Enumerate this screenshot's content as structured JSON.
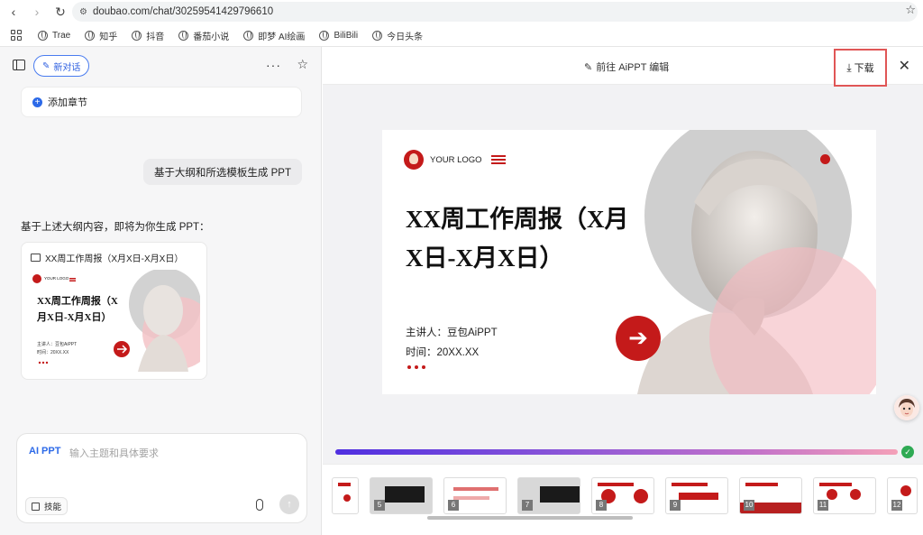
{
  "browser": {
    "url": "doubao.com/chat/30259541429796610",
    "bookmarks": [
      {
        "label": "Trae",
        "icon": "globe-icon"
      },
      {
        "label": "知乎",
        "icon": "globe-icon"
      },
      {
        "label": "抖音",
        "icon": "globe-icon"
      },
      {
        "label": "番茄小说",
        "icon": "globe-icon"
      },
      {
        "label": "即梦 AI绘画",
        "icon": "globe-icon"
      },
      {
        "label": "BiliBili",
        "icon": "globe-icon"
      },
      {
        "label": "今日头条",
        "icon": "globe-icon"
      }
    ]
  },
  "chat": {
    "new_chat_label": "新对话",
    "add_chapter_label": "添加章节",
    "user_message": "基于大纲和所选模板生成 PPT",
    "bot_message": "基于上述大纲内容，即将为你生成 PPT：",
    "ppt_card_title": "XX周工作周报（X月X日-X月X日）",
    "mini_slide": {
      "logo_text": "YOUR LOGO",
      "title": "XX周工作周报（X月X日-X月X日）",
      "presenter": "主讲人：豆包AiPPT",
      "time": "时间：20XX.XX"
    },
    "input": {
      "tag": "AI PPT",
      "placeholder": "输入主题和具体要求",
      "skill_label": "技能"
    }
  },
  "preview": {
    "goto_edit_label": "前往 AiPPT 编辑",
    "download_label": "下载",
    "slide": {
      "logo_text": "YOUR LOGO",
      "title": "XX周工作周报（X月X日-X月X日）",
      "presenter": "主讲人：豆包AiPPT",
      "time": "时间：20XX.XX"
    },
    "progress_percent": 100,
    "thumbnails": [
      "5",
      "6",
      "7",
      "8",
      "9",
      "10",
      "11",
      "12"
    ],
    "colors": {
      "accent": "#c41a1a",
      "highlight": "#e05656",
      "link": "#2d6ae8"
    }
  }
}
